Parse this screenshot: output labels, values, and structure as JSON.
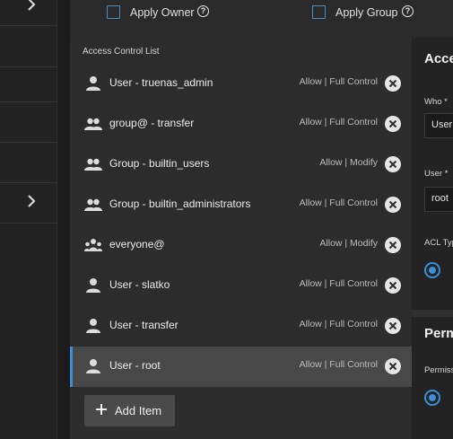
{
  "owner_options": {
    "apply_owner_label": "Apply Owner",
    "apply_group_label": "Apply Group",
    "help_glyph": "?"
  },
  "acl": {
    "title": "Access Control List",
    "items": [
      {
        "name": "User - truenas_admin",
        "permission": "Allow | Full Control",
        "icon": "user-icon",
        "selected": false
      },
      {
        "name": "group@ - transfer",
        "permission": "Allow | Full Control",
        "icon": "group-icon",
        "selected": false
      },
      {
        "name": "Group - builtin_users",
        "permission": "Allow | Modify",
        "icon": "group-icon",
        "selected": false
      },
      {
        "name": "Group - builtin_administrators",
        "permission": "Allow | Full Control",
        "icon": "group-icon",
        "selected": false
      },
      {
        "name": "everyone@",
        "permission": "Allow | Modify",
        "icon": "everyone-icon",
        "selected": false
      },
      {
        "name": "User - slatko",
        "permission": "Allow | Full Control",
        "icon": "user-icon",
        "selected": false
      },
      {
        "name": "User - transfer",
        "permission": "Allow | Full Control",
        "icon": "user-icon",
        "selected": false
      },
      {
        "name": "User - root",
        "permission": "Allow | Full Control",
        "icon": "user-icon",
        "selected": true
      }
    ],
    "add_item_label": "Add Item"
  },
  "editor": {
    "heading": "Acce",
    "who_label": "Who *",
    "who_value": "User",
    "user_label": "User *",
    "user_value": "root",
    "acl_type_label": "ACL Typ",
    "permissions_heading": "Perm",
    "permissions_label": "Permiss"
  },
  "colors": {
    "accent": "#3b8fd6",
    "selected_row": "#484848"
  }
}
